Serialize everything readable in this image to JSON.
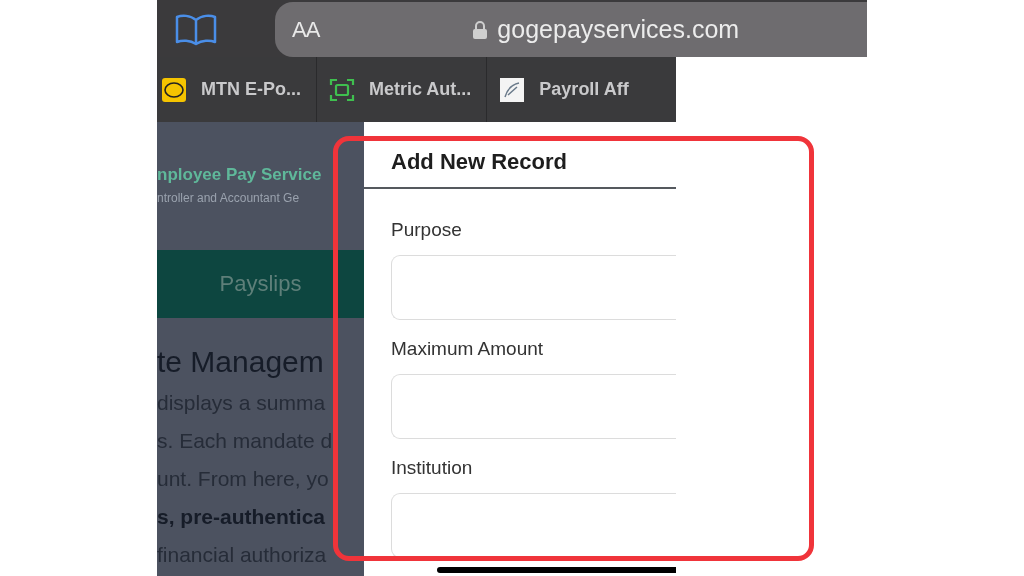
{
  "browser": {
    "text_size_button": "AA",
    "address": "gogepayservices.com",
    "secure": true
  },
  "tabs": [
    {
      "label": "MTN E-Po...",
      "kind": "mtn",
      "selected": false
    },
    {
      "label": "Metric Aut...",
      "kind": "metric",
      "selected": false
    },
    {
      "label": "Payroll Aff",
      "kind": "payroll",
      "selected": false
    }
  ],
  "background_page": {
    "header_title": "nployee Pay Service",
    "header_subtitle": "ntroller and Accountant Ge",
    "nav_item": "Payslips",
    "heading": "te Managem",
    "paragraph_lines": [
      {
        "text": "displays a summa",
        "bold": false
      },
      {
        "text": "s. Each mandate d",
        "bold": false
      },
      {
        "text": "unt. From here, yo",
        "bold": false
      },
      {
        "text": "s, pre-authentica",
        "bold": true
      },
      {
        "text": "financial authoriza",
        "bold": false
      }
    ]
  },
  "modal": {
    "title": "Add New Record",
    "fields": [
      {
        "label": "Purpose"
      },
      {
        "label": "Maximum Amount"
      },
      {
        "label": "Institution"
      }
    ]
  },
  "annotation": {
    "kind": "rectangle"
  }
}
